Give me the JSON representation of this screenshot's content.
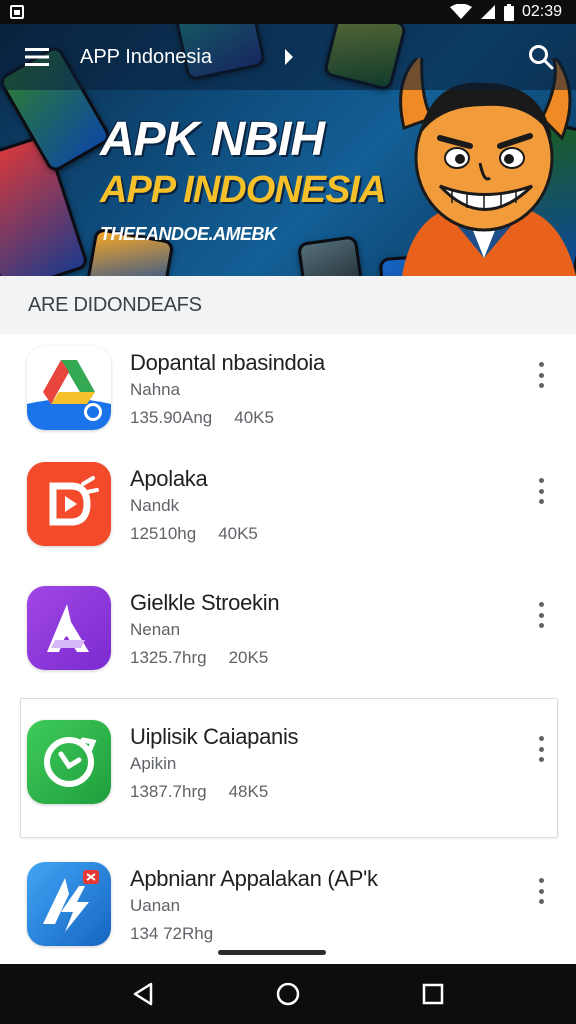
{
  "status_bar": {
    "time": "02:39",
    "icons": [
      "notification-icon",
      "wifi-icon",
      "signal-icon",
      "battery-icon"
    ]
  },
  "app_bar": {
    "title": "APP Indonesia",
    "menu_icon": "hamburger-menu-icon",
    "search_icon": "search-icon",
    "chevron_icon": "chevron-right-icon"
  },
  "hero": {
    "line1": "APK NBIH",
    "line2": "APP INDONESIA",
    "line3": "THEEANDOE.AMEBK"
  },
  "section": {
    "title": "ARE DIDONDEAFS"
  },
  "apps": [
    {
      "name": "Dopantal nbasindoia",
      "sub": "Nahna",
      "size": "135.90Ang",
      "downloads": "40K5",
      "icon": "drive-style-icon",
      "colors": [
        "#e8453c",
        "#34a853",
        "#1a73e8"
      ]
    },
    {
      "name": "Apolaka",
      "sub": "Nandk",
      "size": "12510hg",
      "downloads": "40K5",
      "icon": "play-d-icon",
      "colors": [
        "#f24a2b"
      ]
    },
    {
      "name": "Gielkle Stroekin",
      "sub": "Nenan",
      "size": "1325.7hrg",
      "downloads": "20K5",
      "icon": "a-letter-icon",
      "colors": [
        "#8e35d6"
      ]
    },
    {
      "name": "Uiplisik Caiapanis",
      "sub": "Apikin",
      "size": "1387.7hrg",
      "downloads": "48K5",
      "icon": "refresh-phone-icon",
      "colors": [
        "#27b34a"
      ]
    },
    {
      "name": "Apbnianr Appalakan (AP'k",
      "sub": "Uanan",
      "size": "134 72Rhg",
      "downloads": "",
      "icon": "a-bolt-icon",
      "colors": [
        "#1e88e5"
      ]
    }
  ],
  "nav_bar": {
    "back_icon": "back-triangle-icon",
    "home_icon": "home-circle-icon",
    "recents_icon": "recents-square-icon"
  }
}
